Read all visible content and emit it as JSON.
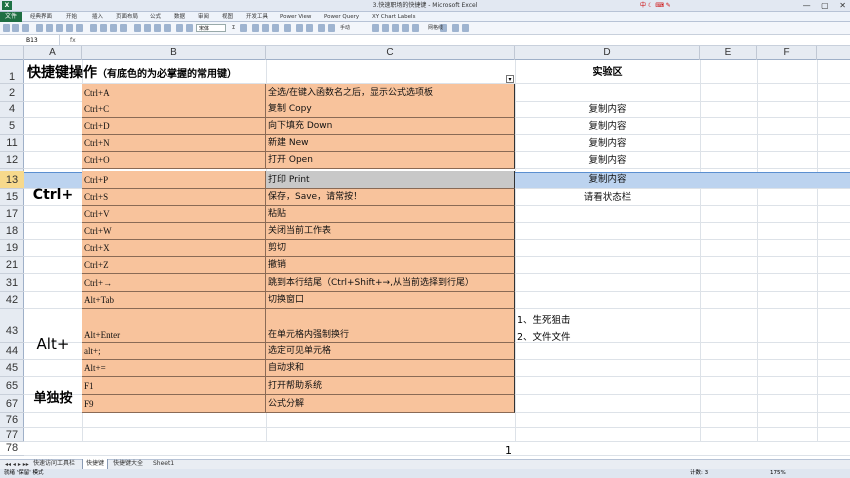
{
  "window": {
    "title": "3.快速职场的快捷键 - Microsoft Excel",
    "ime_label": "中",
    "window_buttons": "— ▢ ✕"
  },
  "ribbon": {
    "file_tab": "文件",
    "tabs": [
      "经典界面",
      "开始",
      "插入",
      "页面布局",
      "公式",
      "数据",
      "审阅",
      "视图",
      "开发工具",
      "Power View",
      "Power Query",
      "XY Chart Labels"
    ]
  },
  "toolbar": {
    "font_name": "宋体",
    "sum_label": "Σ",
    "layout_label": "手动",
    "grid_label": "网格线"
  },
  "formula_bar": {
    "name_box": "B13",
    "fx_label": "fx",
    "content": ""
  },
  "columns": [
    "A",
    "B",
    "C",
    "D",
    "E",
    "F"
  ],
  "sheet": {
    "heading": "快捷键操作",
    "heading_note": "（有底色的为必掌握的常用键）",
    "lab_header": "实验区",
    "groups": [
      "Ctrl+",
      "Alt+",
      "单独按"
    ],
    "rows": [
      {
        "num": "1"
      },
      {
        "num": "2",
        "b": "Ctrl+A",
        "c": "全选/在键入函数名之后，显示公式选项板",
        "d": ""
      },
      {
        "num": "4",
        "b": "Ctrl+C",
        "c": "复制 Copy",
        "d": "复制内容"
      },
      {
        "num": "5",
        "b": "Ctrl+D",
        "c": "向下填充 Down",
        "d": "复制内容"
      },
      {
        "num": "11",
        "b": "Ctrl+N",
        "c": "新建 New",
        "d": "复制内容"
      },
      {
        "num": "12",
        "b": "Ctrl+O",
        "c": "打开 Open",
        "d": "复制内容"
      },
      {
        "num": "13",
        "b": "Ctrl+P",
        "c": "打印 Print",
        "d": "复制内容"
      },
      {
        "num": "15",
        "b": "Ctrl+S",
        "c": "保存，Save，请常按！",
        "d": "请看状态栏"
      },
      {
        "num": "17",
        "b": "Ctrl+V",
        "c": "粘贴",
        "d": ""
      },
      {
        "num": "18",
        "b": "Ctrl+W",
        "c": "关闭当前工作表",
        "d": ""
      },
      {
        "num": "19",
        "b": "Ctrl+X",
        "c": "剪切",
        "d": ""
      },
      {
        "num": "21",
        "b": "Ctrl+Z",
        "c": "撤销",
        "d": ""
      },
      {
        "num": "31",
        "b": "Ctrl+→",
        "c": "跳到本行结尾（Ctrl+Shift+→,从当前选择到行尾）",
        "d": ""
      },
      {
        "num": "42",
        "b": "Alt+Tab",
        "c": "切换窗口",
        "d": ""
      },
      {
        "num": "43",
        "b": "Alt+Enter",
        "c": "在单元格内强制换行",
        "d": ""
      },
      {
        "num": "44",
        "b": "alt+;",
        "c": "选定可见单元格",
        "d": ""
      },
      {
        "num": "45",
        "b": "Alt+=",
        "c": "自动求和",
        "d": ""
      },
      {
        "num": "65",
        "b": "F1",
        "c": "打开帮助系统",
        "d": ""
      },
      {
        "num": "67",
        "b": "F9",
        "c": "公式分解",
        "d": ""
      },
      {
        "num": "76"
      },
      {
        "num": "77"
      },
      {
        "num": "78"
      }
    ],
    "lab_list": [
      "1、生死狙击",
      "2、文件文件"
    ],
    "page_number": "1"
  },
  "sheet_tabs": [
    "快速访问工具栏",
    "快捷键",
    "快捷键大全",
    "Sheet1"
  ],
  "active_sheet_tab": "快捷键",
  "status": {
    "left": "就绪  '保留'  模式",
    "right": "计数: 3",
    "zoom": "175%"
  }
}
